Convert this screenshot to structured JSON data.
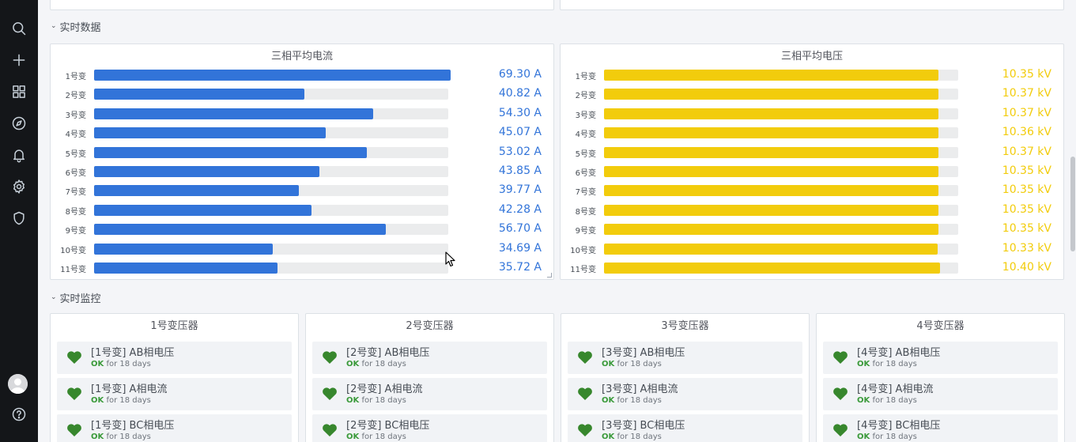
{
  "sidebar": {
    "icons": [
      "search-icon",
      "plus-icon",
      "dashboards-icon",
      "explore-icon",
      "alerting-icon",
      "configuration-icon",
      "shield-icon",
      "user-avatar",
      "help-icon"
    ]
  },
  "rows": {
    "realtime_data": "实时数据",
    "realtime_monitor": "实时监控"
  },
  "current_panel": {
    "title": "三相平均电流",
    "color": "#3274d9",
    "value_color": "#3274d9",
    "max": 69.3,
    "items": [
      {
        "label": "1号变",
        "value": 69.3,
        "display": "69.30 A"
      },
      {
        "label": "2号变",
        "value": 40.82,
        "display": "40.82 A"
      },
      {
        "label": "3号变",
        "value": 54.3,
        "display": "54.30 A"
      },
      {
        "label": "4号变",
        "value": 45.07,
        "display": "45.07 A"
      },
      {
        "label": "5号变",
        "value": 53.02,
        "display": "53.02 A"
      },
      {
        "label": "6号变",
        "value": 43.85,
        "display": "43.85 A"
      },
      {
        "label": "7号变",
        "value": 39.77,
        "display": "39.77 A"
      },
      {
        "label": "8号变",
        "value": 42.28,
        "display": "42.28 A"
      },
      {
        "label": "9号变",
        "value": 56.7,
        "display": "56.70 A"
      },
      {
        "label": "10号变",
        "value": 34.69,
        "display": "34.69 A"
      },
      {
        "label": "11号变",
        "value": 35.72,
        "display": "35.72 A"
      }
    ]
  },
  "voltage_panel": {
    "title": "三相平均电压",
    "color": "#f2cc0c",
    "value_color": "#f2cc0c",
    "max": 10.97,
    "items": [
      {
        "label": "1号变",
        "value": 10.35,
        "display": "10.35 kV"
      },
      {
        "label": "2号变",
        "value": 10.37,
        "display": "10.37 kV"
      },
      {
        "label": "3号变",
        "value": 10.37,
        "display": "10.37 kV"
      },
      {
        "label": "4号变",
        "value": 10.36,
        "display": "10.36 kV"
      },
      {
        "label": "5号变",
        "value": 10.37,
        "display": "10.37 kV"
      },
      {
        "label": "6号变",
        "value": 10.35,
        "display": "10.35 kV"
      },
      {
        "label": "7号变",
        "value": 10.35,
        "display": "10.35 kV"
      },
      {
        "label": "8号变",
        "value": 10.35,
        "display": "10.35 kV"
      },
      {
        "label": "9号变",
        "value": 10.35,
        "display": "10.35 kV"
      },
      {
        "label": "10号变",
        "value": 10.33,
        "display": "10.33 kV"
      },
      {
        "label": "11号变",
        "value": 10.4,
        "display": "10.40 kV"
      }
    ]
  },
  "monitors": [
    {
      "title": "1号变压器",
      "items": [
        {
          "name": "[1号变] AB相电压",
          "state": "OK",
          "duration": "for 18 days"
        },
        {
          "name": "[1号变] A相电流",
          "state": "OK",
          "duration": "for 18 days"
        },
        {
          "name": "[1号变] BC相电压",
          "state": "OK",
          "duration": "for 18 days"
        }
      ]
    },
    {
      "title": "2号变压器",
      "items": [
        {
          "name": "[2号变] AB相电压",
          "state": "OK",
          "duration": "for 18 days"
        },
        {
          "name": "[2号变] A相电流",
          "state": "OK",
          "duration": "for 18 days"
        },
        {
          "name": "[2号变] BC相电压",
          "state": "OK",
          "duration": "for 18 days"
        }
      ]
    },
    {
      "title": "3号变压器",
      "items": [
        {
          "name": "[3号变] AB相电压",
          "state": "OK",
          "duration": "for 18 days"
        },
        {
          "name": "[3号变] A相电流",
          "state": "OK",
          "duration": "for 18 days"
        },
        {
          "name": "[3号变] BC相电压",
          "state": "OK",
          "duration": "for 18 days"
        }
      ]
    },
    {
      "title": "4号变压器",
      "items": [
        {
          "name": "[4号变] AB相电压",
          "state": "OK",
          "duration": "for 18 days"
        },
        {
          "name": "[4号变] A相电流",
          "state": "OK",
          "duration": "for 18 days"
        },
        {
          "name": "[4号变] BC相电压",
          "state": "OK",
          "duration": "for 18 days"
        }
      ]
    }
  ],
  "status_color": "#37872d"
}
